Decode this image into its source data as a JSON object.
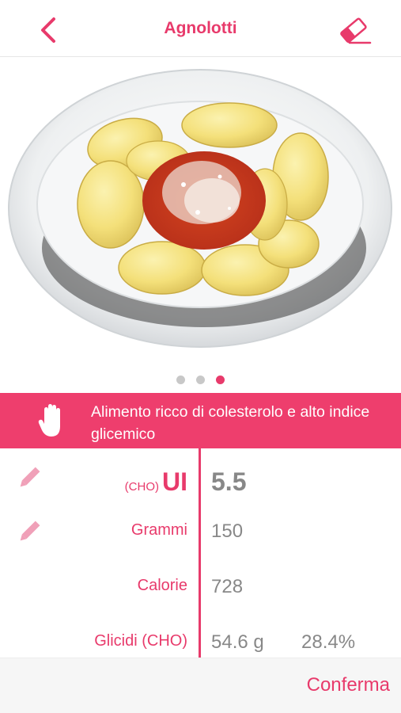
{
  "header": {
    "title": "Agnolotti",
    "back_icon": "chevron-left-icon",
    "eraser_icon": "eraser-icon"
  },
  "carousel": {
    "page_count": 3,
    "active_page": 3
  },
  "alert": {
    "icon": "hand-stop-icon",
    "text": "Alimento ricco di colesterolo e alto indice glicemico"
  },
  "nutrition": {
    "ui": {
      "prefix": "(CHO)",
      "label": "UI",
      "value": "5.5"
    },
    "grams": {
      "label": "Grammi",
      "value": "150"
    },
    "calories": {
      "label": "Calorie",
      "value": "728"
    },
    "carbs": {
      "label": "Glicidi (CHO)",
      "value": "54.6 g",
      "percent": "28.4%"
    }
  },
  "footer": {
    "confirm_label": "Conferma"
  },
  "colors": {
    "accent": "#e83a6b",
    "alert_bg": "#ee3e6d",
    "value_gray": "#888888",
    "dot_inactive": "#c8c8c8"
  }
}
